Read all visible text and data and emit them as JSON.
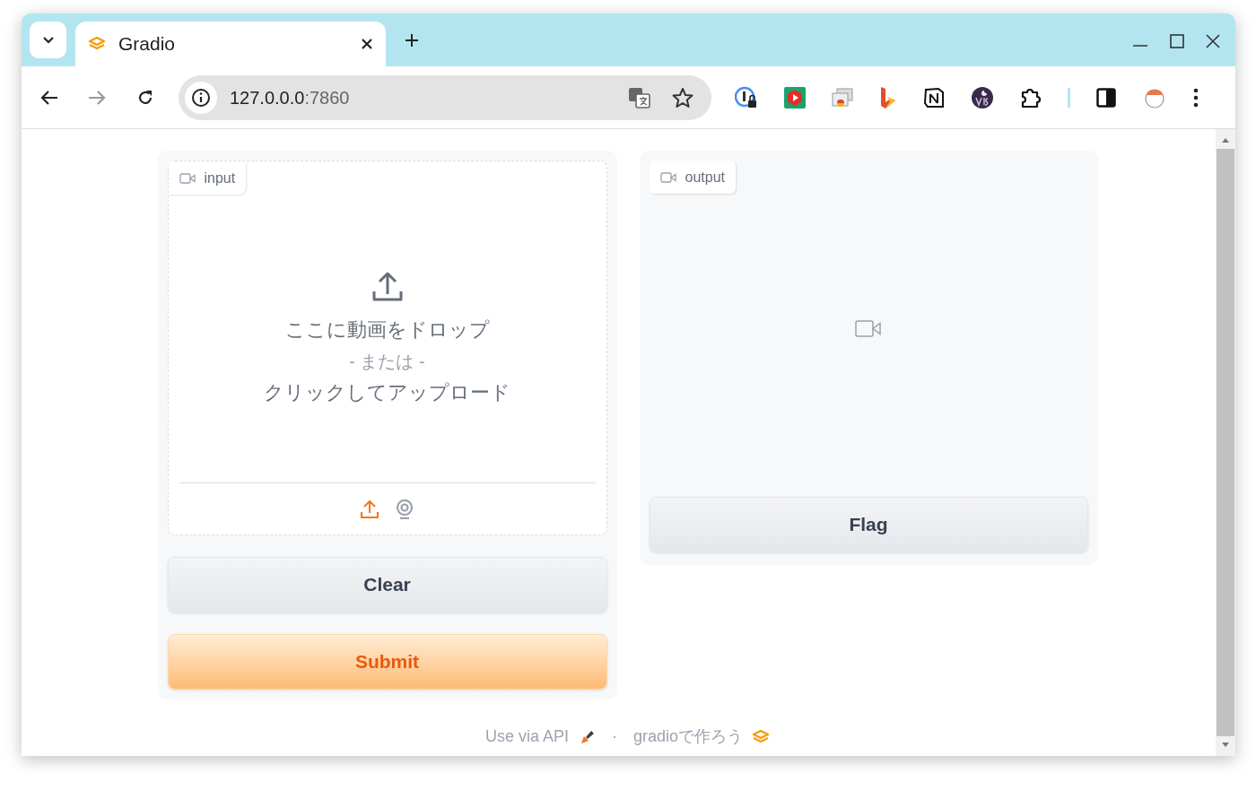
{
  "browser": {
    "tabs": [
      {
        "title": "Gradio",
        "selected": true
      }
    ],
    "url_host": "127.0.0.0",
    "url_port": ":7860"
  },
  "input": {
    "label": "input",
    "drop_text": "ここに動画をドロップ",
    "or_text": "- または -",
    "click_text": "クリックしてアップロード",
    "sources": [
      {
        "kind": "upload",
        "selected": true
      },
      {
        "kind": "webcam",
        "selected": false
      }
    ]
  },
  "buttons": [
    {
      "label": "Clear",
      "kind": "secondary"
    },
    {
      "label": "Submit",
      "kind": "primary"
    }
  ],
  "output": {
    "label": "output"
  },
  "flag_button": "Flag",
  "footer": {
    "api_link": "Use via API",
    "separator": "·",
    "built_with": "gradioで作ろう"
  }
}
